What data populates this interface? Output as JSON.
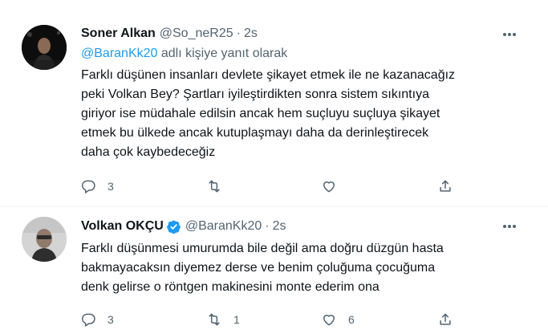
{
  "tweets": [
    {
      "author_name": "Soner Alkan",
      "handle": "@So_neR25",
      "separator": "·",
      "time": "2s",
      "replying_to_mention": "@BaranKk20",
      "replying_to_suffix": "adlı kişiye yanıt olarak",
      "text_lines": [
        "Farklı düşünen insanları devlete şikayet etmek ile ne kazanacağız",
        "peki Volkan Bey? Şartları iyileştirdikten sonra sistem sıkıntıya",
        "giriyor ise müdahale edilsin ancak hem suçluyu suçluya şikayet",
        "etmek bu ülkede ancak kutuplaşmayı daha da derinleştirecek",
        "daha çok kaybedeceğiz"
      ],
      "reply_count": "3",
      "retweet_count": "",
      "like_count": ""
    },
    {
      "author_name": "Volkan OKÇU",
      "handle": "@BaranKk20",
      "separator": "·",
      "time": "2s",
      "text_lines": [
        "Farklı düşünmesi umurumda bile değil ama doğru düzgün hasta",
        "bakmayacaksın diyemez derse ve benim çoluğuma çocuğuma",
        "denk gelirse o röntgen makinesini monte ederim ona"
      ],
      "reply_count": "3",
      "retweet_count": "1",
      "like_count": "6"
    }
  ],
  "colors": {
    "text_primary": "#0f1419",
    "text_secondary": "#536471",
    "accent_blue": "#1d9bf0",
    "divider": "#eff3f4"
  },
  "icons": [
    "more-icon",
    "reply-icon",
    "retweet-icon",
    "like-icon",
    "share-icon",
    "verified-badge-icon"
  ]
}
